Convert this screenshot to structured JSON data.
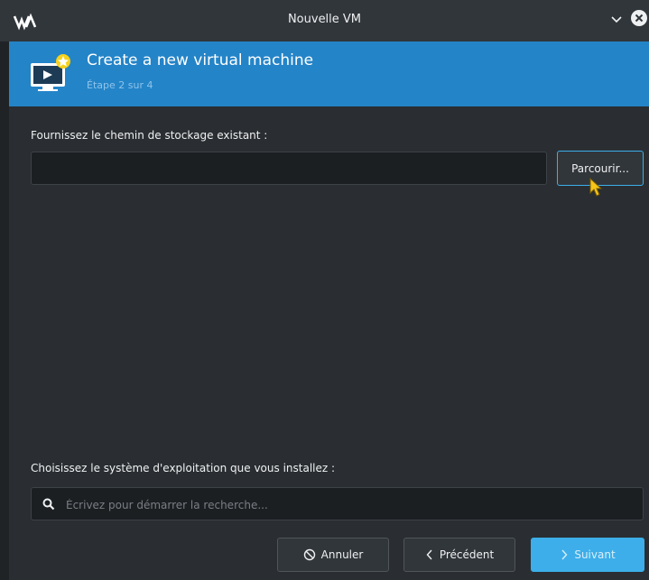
{
  "window": {
    "title": "Nouvelle VM",
    "logo_icon": "virt-manager-logo-icon",
    "minimize_icon": "chevron-down-icon",
    "close_icon": "close-circle-icon"
  },
  "banner": {
    "title": "Create a new virtual machine",
    "step": "Étape 2 sur 4",
    "icon": "vm-monitor-new-icon",
    "background": "#2484c8"
  },
  "storage": {
    "label": "Fournissez le chemin de stockage existant :",
    "value": "",
    "browse_label": "Parcourir..."
  },
  "os": {
    "label": "Choisissez le système d'exploitation que vous installez :",
    "search_placeholder": "Écrivez pour démarrer la recherche...",
    "search_icon": "search-icon"
  },
  "footer": {
    "cancel_label": "Annuler",
    "cancel_icon": "cancel-circle-icon",
    "previous_label": "Précédent",
    "previous_icon": "chevron-left-icon",
    "next_label": "Suivant",
    "next_icon": "chevron-right-icon"
  },
  "colors": {
    "accent": "#3daee9",
    "background": "#2a2e32"
  }
}
